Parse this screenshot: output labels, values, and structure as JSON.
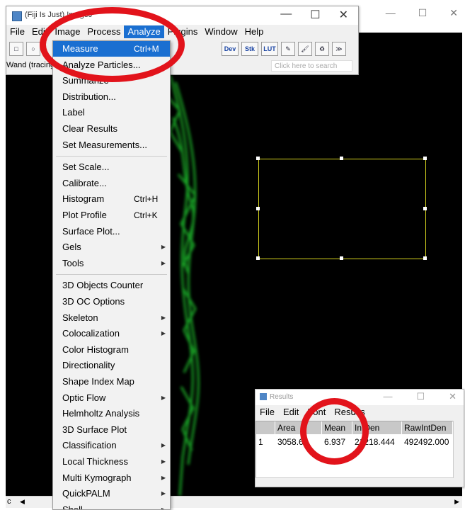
{
  "image_window": {
    "controls": [
      "—",
      "☐",
      "✕"
    ],
    "scroll_label": "c"
  },
  "fiji": {
    "title": "(Fiji Is Just) ImageJ",
    "controls": [
      "—",
      "☐",
      "✕"
    ],
    "menu": [
      "File",
      "Edit",
      "Image",
      "Process",
      "Analyze",
      "Plugins",
      "Window",
      "Help"
    ],
    "active_menu": "Analyze",
    "toolbar": [
      "□",
      "○",
      "Dev",
      "Stk",
      "LUT",
      "✎",
      "🖌",
      "♻",
      "≫"
    ],
    "status": "Wand (tracing) tool",
    "search_placeholder": "Click here to search"
  },
  "analyze_menu": {
    "items": [
      {
        "label": "Measure",
        "shortcut": "Ctrl+M",
        "highlighted": true
      },
      {
        "label": "Analyze Particles...",
        "shortcut": ""
      },
      {
        "label": "Summarize",
        "shortcut": ""
      },
      {
        "label": "Distribution...",
        "shortcut": ""
      },
      {
        "label": "Label",
        "shortcut": ""
      },
      {
        "label": "Clear Results",
        "shortcut": ""
      },
      {
        "label": "Set Measurements...",
        "shortcut": ""
      },
      {
        "label": "Set Scale...",
        "shortcut": ""
      },
      {
        "label": "Calibrate...",
        "shortcut": ""
      },
      {
        "label": "Histogram",
        "shortcut": "Ctrl+H"
      },
      {
        "label": "Plot Profile",
        "shortcut": "Ctrl+K"
      },
      {
        "label": "Surface Plot...",
        "shortcut": ""
      },
      {
        "label": "Gels",
        "shortcut": "",
        "submenu": true
      },
      {
        "label": "Tools",
        "shortcut": "",
        "submenu": true
      },
      {
        "label": "3D Objects Counter",
        "shortcut": ""
      },
      {
        "label": "3D OC Options",
        "shortcut": ""
      },
      {
        "label": "Skeleton",
        "shortcut": "",
        "submenu": true
      },
      {
        "label": "Colocalization",
        "shortcut": "",
        "submenu": true
      },
      {
        "label": "Color Histogram",
        "shortcut": ""
      },
      {
        "label": "Directionality",
        "shortcut": ""
      },
      {
        "label": "Shape Index Map",
        "shortcut": ""
      },
      {
        "label": "Optic Flow",
        "shortcut": "",
        "submenu": true
      },
      {
        "label": "Helmholtz Analysis",
        "shortcut": ""
      },
      {
        "label": "3D Surface Plot",
        "shortcut": ""
      },
      {
        "label": "Classification",
        "shortcut": "",
        "submenu": true
      },
      {
        "label": "Local Thickness",
        "shortcut": "",
        "submenu": true
      },
      {
        "label": "Multi Kymograph",
        "shortcut": "",
        "submenu": true
      },
      {
        "label": "QuickPALM",
        "shortcut": "",
        "submenu": true
      },
      {
        "label": "Shell",
        "shortcut": "",
        "submenu": true
      }
    ],
    "submenu_glyph": "▶"
  },
  "results": {
    "title": "Results",
    "controls": [
      "—",
      "☐",
      "✕"
    ],
    "menu": [
      "File",
      "Edit",
      "Font",
      "Results"
    ],
    "columns": [
      "",
      "Area",
      "Mean",
      "IntDen",
      "RawIntDen"
    ],
    "row": [
      "1",
      "3058.6",
      "6.937",
      "21218.444",
      "492492.000"
    ]
  },
  "annotations": {
    "color": "#e2131b",
    "targets": [
      "Measure menu item",
      "Mean column value"
    ]
  }
}
